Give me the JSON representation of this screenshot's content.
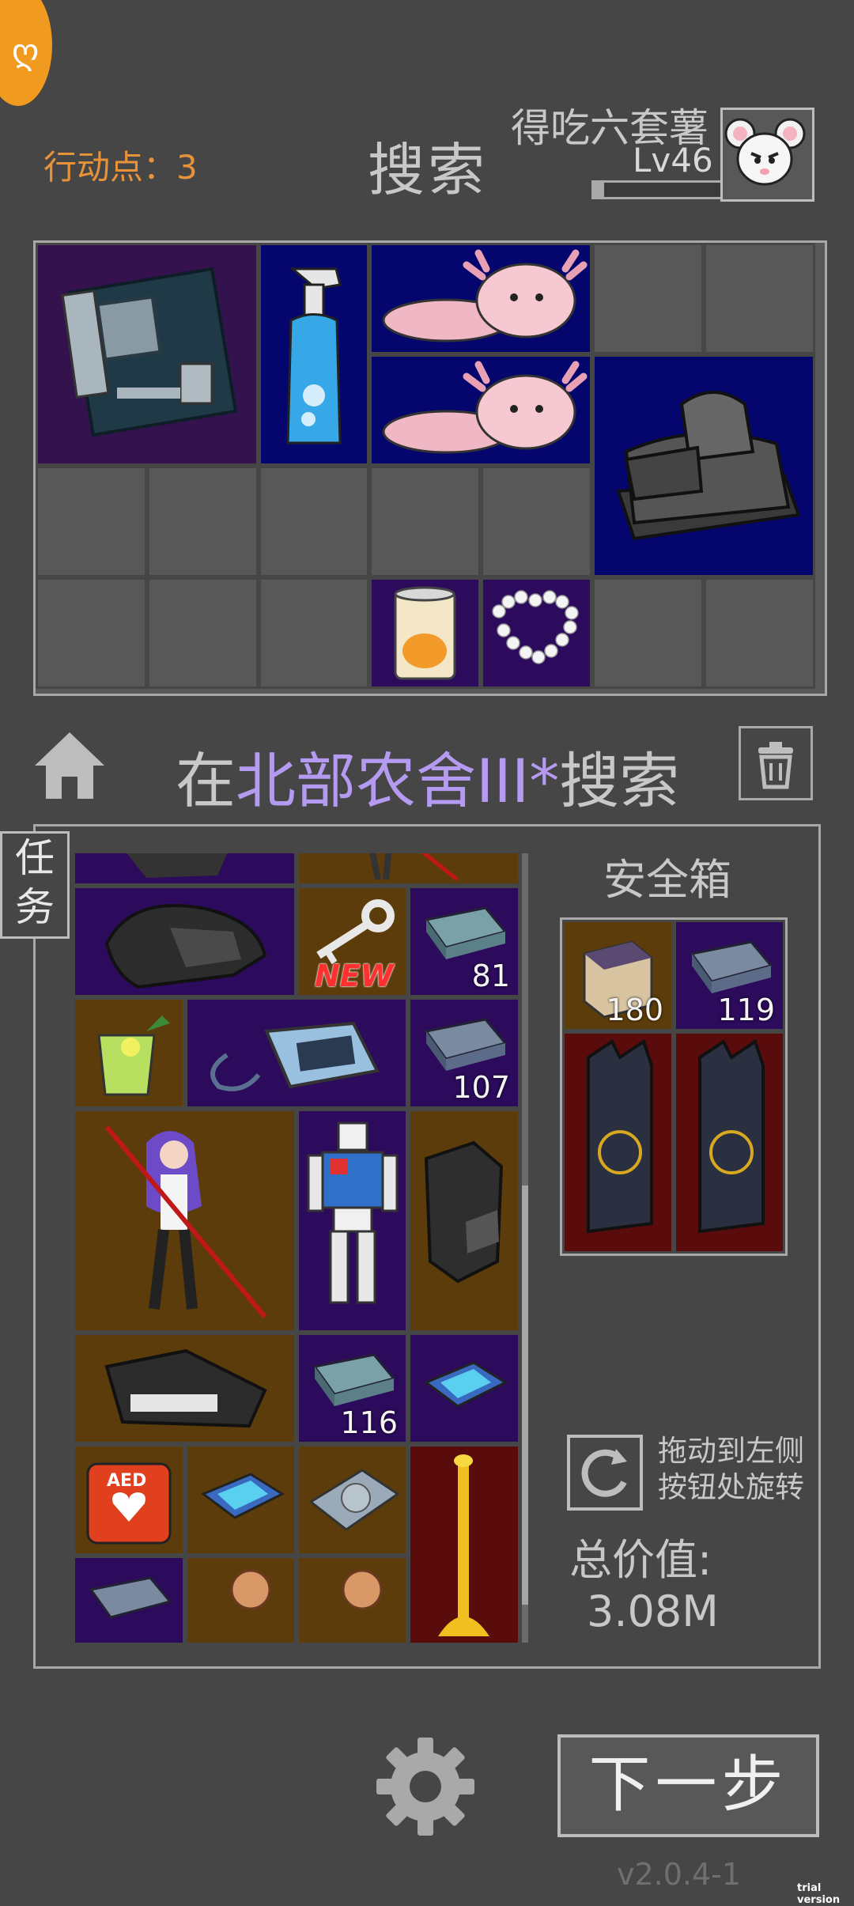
{
  "header": {
    "action_points": "行动点：3",
    "title": "搜索",
    "player_name": "得吃六套薯",
    "level": "Lv46",
    "xp_fraction": 0.08
  },
  "location": {
    "prefix": "在",
    "name": "北部农舍III*",
    "suffix": "搜索"
  },
  "task_tab": "任务",
  "inventory": {
    "quantities": {
      "eraser1": "81",
      "eraser2": "107",
      "eraser3": "116"
    },
    "new_badge": "NEW"
  },
  "safe_box": {
    "title": "安全箱",
    "quantities": {
      "box": "180",
      "eraser": "119"
    }
  },
  "rotate_hint": "拖动到左侧\n按钮处旋转",
  "total_value": {
    "label": "总价值:",
    "value": "3.08M"
  },
  "next_button": "下一步",
  "version": "v2.0.4-1",
  "watermark": "trial version",
  "colors": {
    "bg": "#464646",
    "accent_orange": "#e8923a",
    "location_highlight": "#b49af0",
    "slot_blue": "#05056e",
    "slot_purple": "#2c0a5c",
    "slot_brown": "#5c3c0a",
    "slot_red": "#5a0c0c"
  }
}
